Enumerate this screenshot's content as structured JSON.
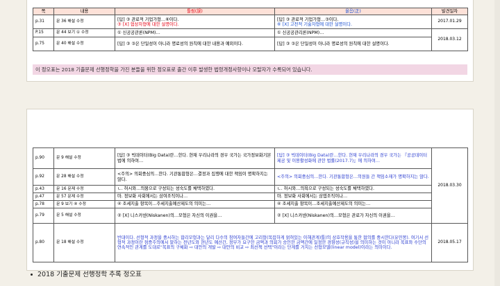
{
  "table1": {
    "header": {
      "page": "쪽",
      "content": "내용",
      "wrong": "틀림(誤)",
      "right": "옳음(正)",
      "date": "발견일자"
    },
    "rows": [
      {
        "page": "p.31",
        "item": "문 36 해설 수정",
        "wrong_a": "[답] ③ 관료적 기업가형…⑥이다.",
        "wrong_b": "③ [X] 협상자형에 대한 설명이다.",
        "right_a": "[답] ③ 관료적 기업가형…③이다.",
        "right_b": "⑥ [X] 고전적 기술자형에 대한 설명이다."
      },
      {
        "page": "P.15",
        "item": "문 44 보기 ① 수정",
        "wrong_a": "① 신공공관론(NPM)…",
        "right_a": "① 신공공관리론(NPM)…"
      },
      {
        "page": "p.75",
        "item": "문 40 해설 수정",
        "wrong_a": "[답] ③ ③은 단일성이 아니라 명료성의 원칙에 대한 내용과 예외이다.",
        "right_a": "[답] ③ ③은 단일성이 아니라 명료성의 원칙에 대한 설명이다."
      }
    ],
    "date_a": "2017.01.29",
    "date_b": "2018.03.12"
  },
  "note": "이 정오표는 2018 기출문제 선행정학을 가진 분들을 위한 정오표로 출간 이후 발생한 법령개정사항이나 오탈자가 수록되어 있습니다.",
  "table2": {
    "rows": [
      {
        "page": "p.90",
        "item": "문 9 해설 수정",
        "wrong": "[답] ③ 빅데이터(Big Data)란…한다. 현재 우리나라의 경우 국가는 국가정보화기본법에 의하여…",
        "right": "[답] ③ 빅데이터(Big Data)란…한다. 현재 우리나라의 경우 국가는 『공공데이터 제공 및 이용활성화에 관한 법률(2017.7)』에 의하여…"
      },
      {
        "page": "p.92",
        "item": "문 28 해설 수정",
        "wrong": "<주의> 의회중심의…한다. 기관통합형은…결정과 집행에 대한 책임이 명확하지는 않다.",
        "right": "<주의> 의회중심의…한다. 기관통합형은…의원들 간 책임소재가 명확하지는 않다."
      },
      {
        "page": "p.43",
        "item": "문 16 문제 수정",
        "wrong": "ㄴ. 허시와…의뮹으로 구성되는 성숙도를 채택하였다.",
        "right": "ㄴ. 허시와…의욕으로 구성되는 성숙도를 채택하였다."
      },
      {
        "page": "p.47",
        "item": "문 57 문제 수정",
        "wrong": "마. 정보화 사회에서는 삼여조직이나…",
        "right": "마. 정보화 사회에서는 삼엽조직이나…"
      },
      {
        "page": "p.78",
        "item": "문 9 보기 ④ 수정",
        "wrong": "④ 조세지출 항목이…주세지출예산제도의 의미는…",
        "right": "④ 조세지출 항목이…조세지출예산제도의 의미는…"
      },
      {
        "page": "p.79",
        "item": "문 5 해설 수정",
        "wrong": "② [X] 니스카넨(Niskanen)의…모형은 자신의 이권을…",
        "right": "② [X] 니스카넨(Niskanen)의…모형은 관료가 자신의 이권을…"
      },
      {
        "page": "p.80",
        "item": "문 18 해설 수정",
        "wrong": "",
        "right": ""
      }
    ],
    "merged": "반대이다. 선형적 과정을 중시하는 합리모형과는 달리 다수의 참여자들간에 고리형(복잡하게 얽혀있는 이해관계)틀)의 상호작용을 통한 협의를 중시한다(유민봉). 여기서 선형적 과정이란 점증주의에서 말하는 전년도와 현년도 예산간, 정부가 요구한 금액과 의회가 승인한 금액간에 일정한 경향성(규칙성)을 의미하는 것이 아니라 목표와 수단의 연속적인 관계를 도대로\"목표의 구체화 ⇨ 대안의 개발 ⇨ 대안의 비교 ⇨ 최선책 선택\"이라는 단계를 거치는 선형모델(linear model)이라는 의미이다.",
    "date_a": "2018.03.30",
    "date_b": "2018.05.17"
  },
  "footer": "2018 기출문제 선행정학 추록 정오표"
}
